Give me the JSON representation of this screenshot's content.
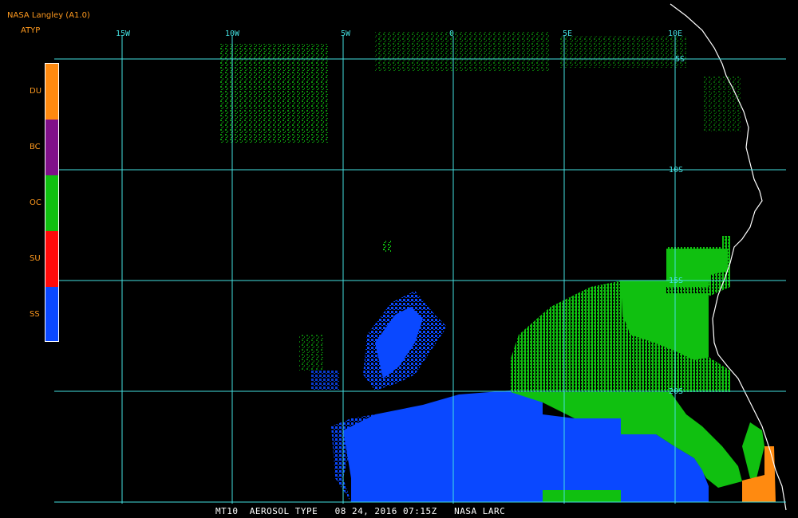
{
  "header": {
    "title": "NASA Langley (A1.0)",
    "product": "ATYP"
  },
  "legend": {
    "items": [
      {
        "code": "DU",
        "color": "#ff8a10"
      },
      {
        "code": "BC",
        "color": "#80108a"
      },
      {
        "code": "OC",
        "color": "#10c010"
      },
      {
        "code": "SU",
        "color": "#ff0a0a"
      },
      {
        "code": "SS",
        "color": "#0a48ff"
      }
    ]
  },
  "grid": {
    "color": "#43e0e0",
    "lon_labels": [
      "15W",
      "10W",
      "5W",
      "0",
      "5E",
      "10E"
    ],
    "lat_labels": [
      "5S",
      "10S",
      "15S",
      "20S"
    ]
  },
  "colors": {
    "ocean": "#000000",
    "coast": "#ffffff"
  },
  "footer": {
    "text": "MT10  AEROSOL TYPE   08 24, 2016 07:15Z   NASA LARC"
  }
}
